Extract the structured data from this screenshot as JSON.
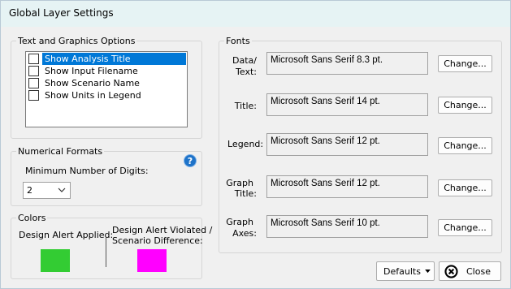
{
  "window": {
    "title": "Global Layer Settings"
  },
  "text_graphics": {
    "legend": "Text and Graphics Options",
    "items": [
      {
        "label": "Show Analysis Title",
        "checked": false,
        "selected": true
      },
      {
        "label": "Show Input Filename",
        "checked": false,
        "selected": false
      },
      {
        "label": "Show Scenario Name",
        "checked": false,
        "selected": false
      },
      {
        "label": "Show Units in Legend",
        "checked": false,
        "selected": false
      }
    ]
  },
  "numerical": {
    "legend": "Numerical Formats",
    "min_digits_label": "Minimum Number of Digits:",
    "min_digits_value": "2",
    "help_icon": "question-circle-icon"
  },
  "colors": {
    "legend": "Colors",
    "applied_label": "Design Alert Applied:",
    "applied_color": "#33cc33",
    "violated_label_line1": "Design Alert Violated /",
    "violated_label_line2": "Scenario Difference:",
    "violated_color": "#ff00ff"
  },
  "fonts": {
    "legend": "Fonts",
    "rows": [
      {
        "label_line1": "Data/",
        "label_line2": "Text:",
        "value": "Microsoft Sans Serif 8.3 pt.",
        "button": "Change..."
      },
      {
        "label_line1": "",
        "label_line2": "Title:",
        "value": "Microsoft Sans Serif 14 pt.",
        "button": "Change..."
      },
      {
        "label_line1": "",
        "label_line2": "Legend:",
        "value": "Microsoft Sans Serif 12 pt.",
        "button": "Change..."
      },
      {
        "label_line1": "Graph",
        "label_line2": "Title:",
        "value": "Microsoft Sans Serif 12 pt.",
        "button": "Change..."
      },
      {
        "label_line1": "Graph",
        "label_line2": "Axes:",
        "value": "Microsoft Sans Serif 10 pt.",
        "button": "Change..."
      }
    ]
  },
  "footer": {
    "defaults_label": "Defaults",
    "close_label": "Close",
    "close_icon": "close-circle-icon"
  }
}
